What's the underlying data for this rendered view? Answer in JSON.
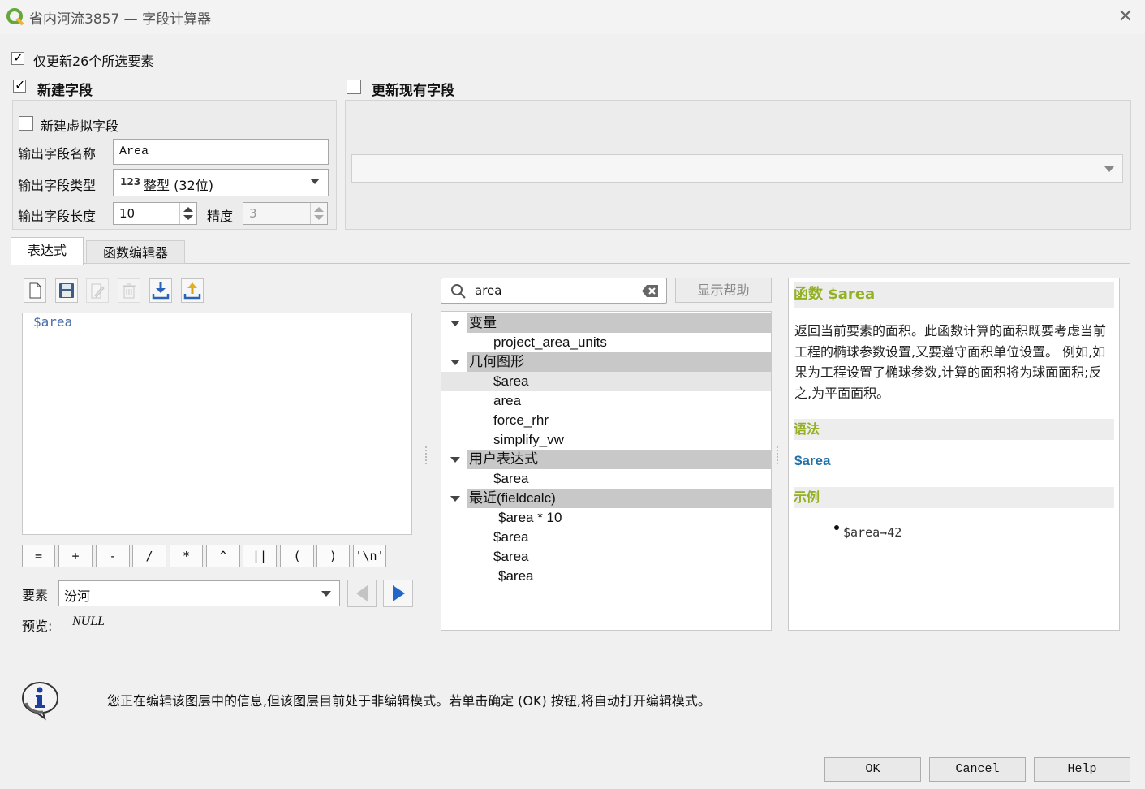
{
  "window": {
    "title": "省内河流3857 — 字段计算器"
  },
  "options": {
    "update_selected_label": "仅更新26个所选要素",
    "update_selected_checked": true,
    "new_field_label": "新建字段",
    "new_field_checked": true,
    "update_existing_label": "更新现有字段",
    "update_existing_checked": false
  },
  "new_field": {
    "virtual_label": "新建虚拟字段",
    "name_label": "输出字段名称",
    "name_value": "Area",
    "type_label": "输出字段类型",
    "type_icon_text": "123",
    "type_value": "整型 (32位)",
    "length_label": "输出字段长度",
    "length_value": "10",
    "precision_label": "精度",
    "precision_value": "3"
  },
  "tabs": [
    {
      "label": "表达式"
    },
    {
      "label": "函数编辑器"
    }
  ],
  "expression": {
    "text": "$area",
    "operators": [
      "=",
      "+",
      "-",
      "/",
      "*",
      "^",
      "||",
      "(",
      ")",
      "'\\n'"
    ],
    "feature_label": "要素",
    "feature_value": "汾河",
    "preview_label": "预览:",
    "preview_value": "NULL"
  },
  "search": {
    "value": "area",
    "show_help_label": "显示帮助"
  },
  "tree": {
    "groups": [
      {
        "label": "变量",
        "items": [
          "project_area_units"
        ]
      },
      {
        "label": "几何图形",
        "items": [
          "$area",
          "area",
          "force_rhr",
          "simplify_vw"
        ]
      },
      {
        "label": "用户表达式",
        "items": [
          "$area"
        ]
      },
      {
        "label": "最近(fieldcalc)",
        "items": [
          "$area * 10",
          "$area",
          "$area",
          "$area"
        ]
      }
    ]
  },
  "help": {
    "title": "函数 $area",
    "description": "返回当前要素的面积。此函数计算的面积既要考虑当前工程的椭球参数设置,又要遵守面积单位设置。 例如,如果为工程设置了椭球参数,计算的面积将为球面面积;反之,为平面面积。",
    "syntax_header": "语法",
    "syntax": "$area",
    "examples_header": "示例",
    "example_code": "$area",
    "example_arrow": "→",
    "example_result": "42"
  },
  "info": {
    "message": "您正在编辑该图层中的信息,但该图层目前处于非编辑模式。若单击确定 (OK) 按钮,将自动打开编辑模式。"
  },
  "buttons": {
    "ok": "OK",
    "cancel": "Cancel",
    "help": "Help"
  },
  "colors": {
    "help_header": "#93b023",
    "syntax_blue": "#1f6fa8",
    "expr_text": "#4a6ea8",
    "play_blue": "#2266cc"
  }
}
